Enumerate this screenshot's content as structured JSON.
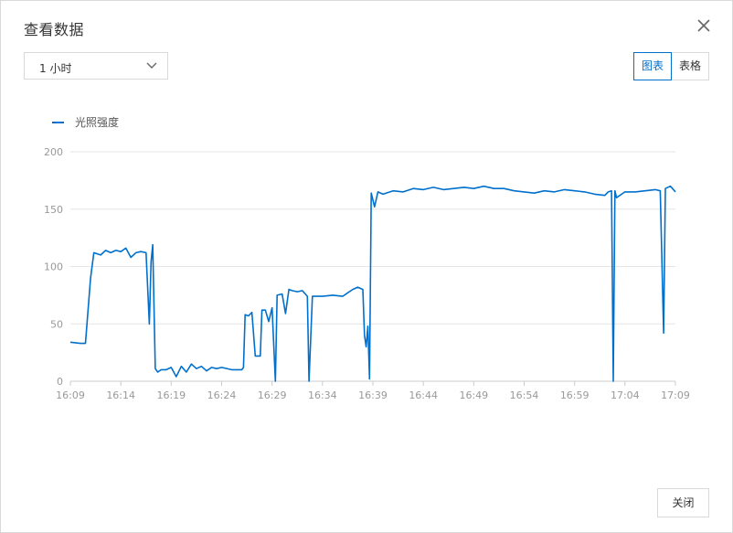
{
  "dialog": {
    "title": "查看数据",
    "close_icon": "close-icon"
  },
  "range_select": {
    "value": "1 小时",
    "icon": "chevron-down-icon"
  },
  "view_toggle": {
    "chart_label": "图表",
    "table_label": "表格",
    "active": "chart"
  },
  "footer": {
    "close_label": "关闭"
  },
  "colors": {
    "series": "#0070cc",
    "grid": "#e5e5e5",
    "axis": "#cccccc",
    "tick_text": "#999999"
  },
  "chart_data": {
    "type": "line",
    "title": "",
    "xlabel": "",
    "ylabel": "",
    "ylim": [
      0,
      200
    ],
    "y_ticks": [
      "0",
      "50",
      "100",
      "150",
      "200"
    ],
    "x_ticks": [
      "16:09",
      "16:14",
      "16:19",
      "16:24",
      "16:29",
      "16:34",
      "16:39",
      "16:44",
      "16:49",
      "16:54",
      "16:59",
      "17:04",
      "17:09"
    ],
    "x_range": [
      "16:09",
      "17:09"
    ],
    "grid": true,
    "legend_position": "top-left",
    "series": [
      {
        "name": "光照强度",
        "points": [
          [
            "16:09:00",
            34
          ],
          [
            "16:10:00",
            33
          ],
          [
            "16:10:30",
            33
          ],
          [
            "16:11:00",
            90
          ],
          [
            "16:11:20",
            112
          ],
          [
            "16:12:00",
            110
          ],
          [
            "16:12:30",
            114
          ],
          [
            "16:13:00",
            112
          ],
          [
            "16:13:30",
            114
          ],
          [
            "16:14:00",
            113
          ],
          [
            "16:14:30",
            116
          ],
          [
            "16:15:00",
            108
          ],
          [
            "16:15:30",
            112
          ],
          [
            "16:16:00",
            113
          ],
          [
            "16:16:30",
            112
          ],
          [
            "16:16:50",
            50
          ],
          [
            "16:17:00",
            104
          ],
          [
            "16:17:10",
            119
          ],
          [
            "16:17:25",
            11
          ],
          [
            "16:17:40",
            8
          ],
          [
            "16:18:00",
            10
          ],
          [
            "16:18:30",
            10
          ],
          [
            "16:19:00",
            12
          ],
          [
            "16:19:30",
            4
          ],
          [
            "16:20:00",
            13
          ],
          [
            "16:20:30",
            8
          ],
          [
            "16:21:00",
            15
          ],
          [
            "16:21:30",
            11
          ],
          [
            "16:22:00",
            13
          ],
          [
            "16:22:30",
            9
          ],
          [
            "16:23:00",
            12
          ],
          [
            "16:23:30",
            11
          ],
          [
            "16:24:00",
            12
          ],
          [
            "16:25:00",
            10
          ],
          [
            "16:26:00",
            10
          ],
          [
            "16:26:10",
            12
          ],
          [
            "16:26:20",
            58
          ],
          [
            "16:26:40",
            57
          ],
          [
            "16:27:00",
            60
          ],
          [
            "16:27:20",
            22
          ],
          [
            "16:27:50",
            22
          ],
          [
            "16:28:00",
            62
          ],
          [
            "16:28:20",
            62
          ],
          [
            "16:28:40",
            52
          ],
          [
            "16:29:00",
            64
          ],
          [
            "16:29:20",
            0
          ],
          [
            "16:29:30",
            75
          ],
          [
            "16:30:00",
            76
          ],
          [
            "16:30:20",
            59
          ],
          [
            "16:30:40",
            80
          ],
          [
            "16:31:00",
            79
          ],
          [
            "16:31:30",
            78
          ],
          [
            "16:32:00",
            79
          ],
          [
            "16:32:30",
            74
          ],
          [
            "16:32:40",
            0
          ],
          [
            "16:33:00",
            74
          ],
          [
            "16:34:00",
            74
          ],
          [
            "16:35:00",
            75
          ],
          [
            "16:36:00",
            74
          ],
          [
            "16:37:00",
            80
          ],
          [
            "16:37:30",
            82
          ],
          [
            "16:38:00",
            80
          ],
          [
            "16:38:10",
            40
          ],
          [
            "16:38:20",
            30
          ],
          [
            "16:38:30",
            48
          ],
          [
            "16:38:40",
            2
          ],
          [
            "16:38:50",
            164
          ],
          [
            "16:39:10",
            152
          ],
          [
            "16:39:30",
            165
          ],
          [
            "16:40:00",
            163
          ],
          [
            "16:41:00",
            166
          ],
          [
            "16:42:00",
            165
          ],
          [
            "16:43:00",
            168
          ],
          [
            "16:44:00",
            167
          ],
          [
            "16:45:00",
            169
          ],
          [
            "16:46:00",
            167
          ],
          [
            "16:47:00",
            168
          ],
          [
            "16:48:00",
            169
          ],
          [
            "16:49:00",
            168
          ],
          [
            "16:50:00",
            170
          ],
          [
            "16:51:00",
            168
          ],
          [
            "16:52:00",
            168
          ],
          [
            "16:53:00",
            166
          ],
          [
            "16:54:00",
            165
          ],
          [
            "16:55:00",
            164
          ],
          [
            "16:56:00",
            166
          ],
          [
            "16:57:00",
            165
          ],
          [
            "16:58:00",
            167
          ],
          [
            "16:59:00",
            166
          ],
          [
            "17:00:00",
            165
          ],
          [
            "17:01:00",
            163
          ],
          [
            "17:02:00",
            162
          ],
          [
            "17:02:20",
            165
          ],
          [
            "17:02:40",
            166
          ],
          [
            "17:02:50",
            0
          ],
          [
            "17:03:00",
            166
          ],
          [
            "17:03:10",
            160
          ],
          [
            "17:04:00",
            165
          ],
          [
            "17:05:00",
            165
          ],
          [
            "17:06:00",
            166
          ],
          [
            "17:07:00",
            167
          ],
          [
            "17:07:30",
            166
          ],
          [
            "17:07:50",
            42
          ],
          [
            "17:08:00",
            168
          ],
          [
            "17:08:30",
            170
          ],
          [
            "17:09:00",
            165
          ]
        ]
      }
    ]
  }
}
